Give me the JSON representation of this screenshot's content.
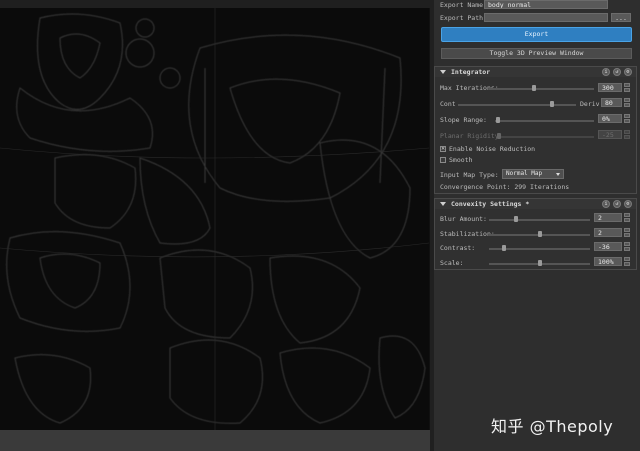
{
  "export": {
    "name_label": "Export Name:",
    "name_value": "body_normal",
    "path_label": "Export Path:",
    "path_value": "",
    "browse_label": "...",
    "export_button": "Export",
    "toggle_button": "Toggle 3D Preview Window"
  },
  "integrator": {
    "title": "Integrator",
    "max_iterations": {
      "label": "Max Iterations:",
      "value": "300",
      "fill": 0.42
    },
    "cont": {
      "label": "Cont",
      "fill": 0.8
    },
    "deriv": {
      "label": "Deriv",
      "value": "80"
    },
    "slope_range": {
      "label": "Slope Range:",
      "value": "0%",
      "fill": 0.03
    },
    "planar_rigidity": {
      "label": "Planar Rigidity:",
      "value": "-25",
      "fill": 0.02
    },
    "enable_noise_reduction": {
      "label": "Enable Noise Reduction",
      "checked": true,
      "mark": "✕"
    },
    "smooth": {
      "label": "Smooth",
      "checked": false
    },
    "input_map_type": {
      "label": "Input Map Type:",
      "value": "Normal Map"
    },
    "convergence": "Convergence Point: 299 Iterations"
  },
  "convexity": {
    "title": "Convexity Settings *",
    "blur_amount": {
      "label": "Blur Amount:",
      "value": "2",
      "fill": 0.27
    },
    "stabilization": {
      "label": "Stabilization:",
      "value": "2",
      "fill": 0.5
    },
    "contrast": {
      "label": "Contrast:",
      "value": "-36",
      "fill": 0.15
    },
    "scale": {
      "label": "Scale:",
      "value": "100%",
      "fill": 0.5
    }
  },
  "watermark": "知乎 @Thepoly"
}
